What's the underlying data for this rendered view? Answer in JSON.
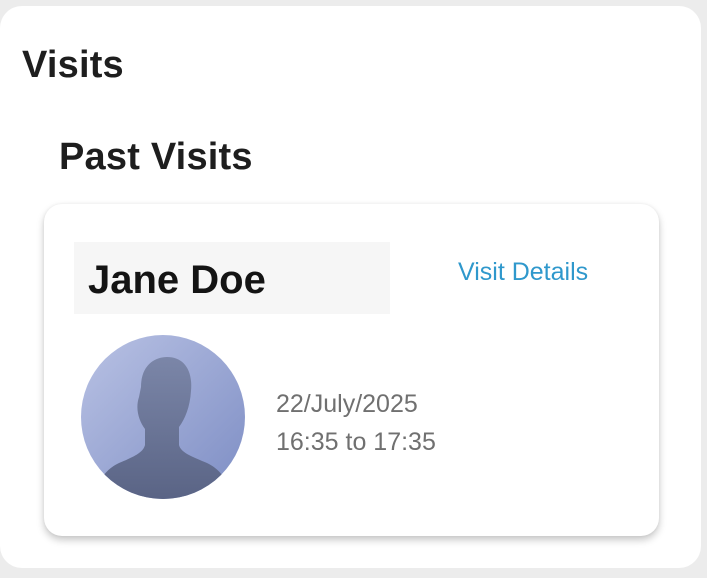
{
  "page": {
    "title": "Visits"
  },
  "section": {
    "title": "Past Visits"
  },
  "visit": {
    "name": "Jane Doe",
    "details_link": "Visit Details",
    "date": "22/July/2025",
    "time": "16:35 to 17:35",
    "avatar_icon": "person-silhouette-icon"
  },
  "colors": {
    "link": "#2f98cc",
    "heading": "#1e1e1e",
    "meta_text": "#707070",
    "avatar_bg": "#9fadd6"
  }
}
